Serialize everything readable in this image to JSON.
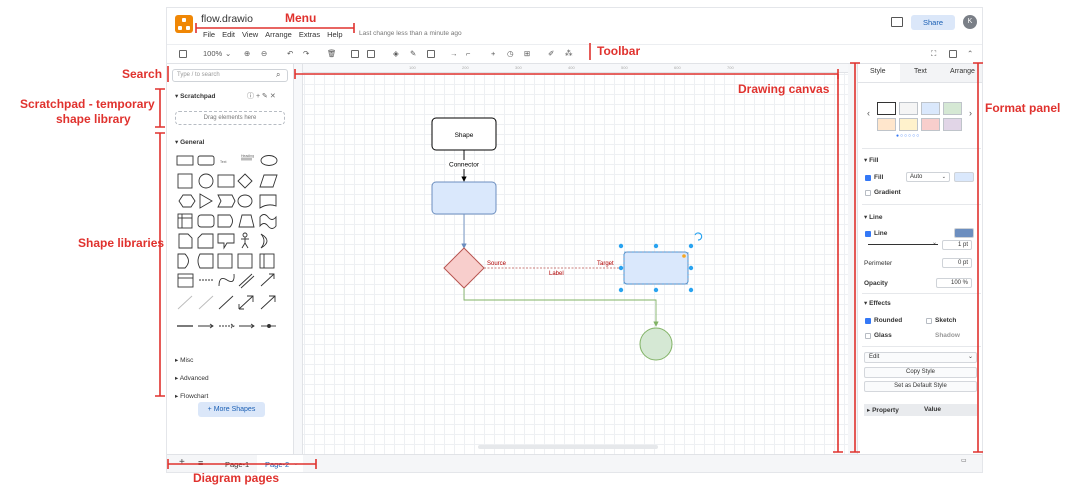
{
  "app": {
    "title": "flow.drawio",
    "menu": [
      "File",
      "Edit",
      "View",
      "Arrange",
      "Extras",
      "Help"
    ],
    "last_change": "Last change less than a minute ago",
    "share_label": "Share",
    "avatar_initial": "K"
  },
  "toolbar": {
    "zoom": "100%"
  },
  "sidebar": {
    "search_placeholder": "Type / to search",
    "scratchpad_title": "Scratchpad",
    "scratchpad_drop": "Drag elements here",
    "general_title": "General",
    "sections": [
      "Misc",
      "Advanced",
      "Flowchart"
    ],
    "more_shapes": "+ More Shapes",
    "tiny_labels": [
      "Text",
      "Heading"
    ]
  },
  "canvas": {
    "ruler_ticks": [
      "100",
      "200",
      "300",
      "400",
      "500",
      "600",
      "700"
    ],
    "shape_label": "Shape",
    "connector_label": "Connector",
    "source_label": "Source",
    "target_label": "Target",
    "edge_label": "Label"
  },
  "format_panel": {
    "tabs": [
      "Style",
      "Text",
      "Arrange"
    ],
    "fill_section": "Fill",
    "fill_label": "Fill",
    "fill_value": "Auto",
    "gradient_label": "Gradient",
    "line_section": "Line",
    "line_label": "Line",
    "line_width": "1 pt",
    "perimeter_label": "Perimeter",
    "perimeter_value": "0 pt",
    "opacity_label": "Opacity",
    "opacity_value": "100 %",
    "effects_section": "Effects",
    "rounded_label": "Rounded",
    "sketch_label": "Sketch",
    "glass_label": "Glass",
    "shadow_label": "Shadow",
    "edit_label": "Edit",
    "copy_style": "Copy Style",
    "set_default_style": "Set as Default Style",
    "property_header": "Property",
    "value_header": "Value"
  },
  "pages": {
    "tabs": [
      "Page-1",
      "Page-2"
    ]
  },
  "annotations": {
    "menu": "Menu",
    "toolbar": "Toolbar",
    "search": "Search",
    "scratchpad": "Scratchpad - temporary",
    "scratchpad2": "shape library",
    "shape_libraries": "Shape libraries",
    "drawing_canvas": "Drawing canvas",
    "format_panel": "Format panel",
    "diagram_pages": "Diagram pages"
  },
  "colors": {
    "annotation": "#e0322e",
    "accent": "#3478f6",
    "selection": "#29a3f0",
    "shape_blue_fill": "#dae8fc",
    "shape_blue_stroke": "#6c8ebf",
    "shape_red_fill": "#f8cecc",
    "shape_red_stroke": "#b85450",
    "shape_green_fill": "#d5e8d4",
    "shape_green_stroke": "#82b366"
  }
}
